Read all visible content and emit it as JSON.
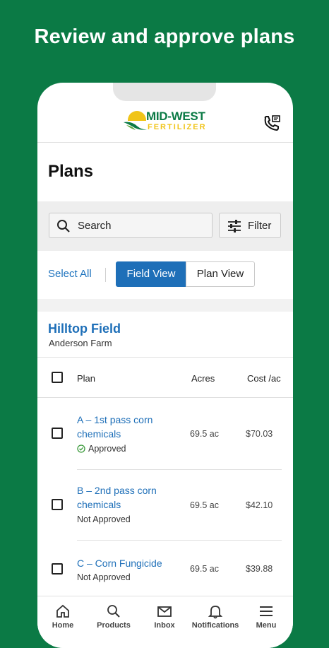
{
  "headline": "Review and approve plans",
  "brand": {
    "logo_top": "MID-WEST",
    "logo_bottom": "FERTILIZER",
    "colors": {
      "green": "#0b7a45",
      "yellow": "#f0c419",
      "link_blue": "#1e6fb8"
    }
  },
  "page_title": "Plans",
  "search": {
    "label": "Search",
    "icon": "search-icon"
  },
  "filter": {
    "label": "Filter",
    "icon": "sliders-icon"
  },
  "select_all": "Select All",
  "view_toggle": {
    "field_view": "Field View",
    "plan_view": "Plan View",
    "active": "Field View"
  },
  "field": {
    "name": "Hilltop Field",
    "farm": "Anderson Farm"
  },
  "table": {
    "headers": {
      "plan": "Plan",
      "acres": "Acres",
      "cost": "Cost /ac"
    },
    "rows": [
      {
        "plan": "A – 1st pass corn chemicals",
        "status": "Approved",
        "acres": "69.5 ac",
        "cost": "$70.03"
      },
      {
        "plan": "B – 2nd pass corn chemicals",
        "status": "Not Approved",
        "acres": "69.5 ac",
        "cost": "$42.10"
      },
      {
        "plan": "C – Corn Fungicide",
        "status": "Not Approved",
        "acres": "69.5 ac",
        "cost": "$39.88"
      }
    ]
  },
  "bottom_nav": [
    {
      "label": "Home",
      "icon": "home-icon"
    },
    {
      "label": "Products",
      "icon": "search-icon"
    },
    {
      "label": "Inbox",
      "icon": "mail-icon"
    },
    {
      "label": "Notifications",
      "icon": "bell-icon"
    },
    {
      "label": "Menu",
      "icon": "hamburger-icon"
    }
  ]
}
